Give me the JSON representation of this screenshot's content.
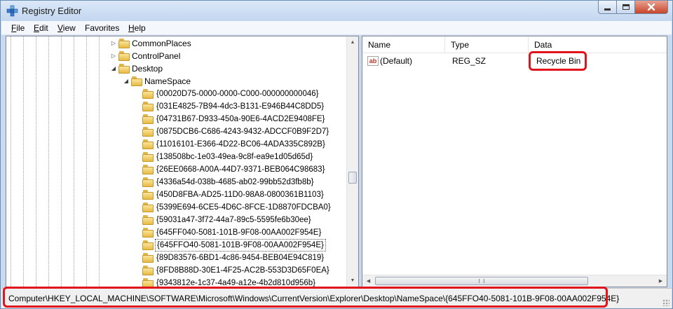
{
  "window": {
    "title": "Registry Editor"
  },
  "menu": [
    {
      "mnemonic": "F",
      "rest": "ile"
    },
    {
      "mnemonic": "E",
      "rest": "dit"
    },
    {
      "mnemonic": "V",
      "rest": "iew"
    },
    {
      "mnemonic": "",
      "rest": "Favorites"
    },
    {
      "mnemonic": "H",
      "rest": "elp"
    }
  ],
  "tree": {
    "parents": [
      {
        "label": "CommonPlaces",
        "state": "collapsed"
      },
      {
        "label": "ControlPanel",
        "state": "collapsed"
      },
      {
        "label": "Desktop",
        "state": "expanded"
      },
      {
        "label": "NameSpace",
        "state": "expanded"
      }
    ],
    "children": [
      "{00020D75-0000-0000-C000-000000000046}",
      "{031E4825-7B94-4dc3-B131-E946B44C8DD5}",
      "{04731B67-D933-450a-90E6-4ACD2E9408FE}",
      "{0875DCB6-C686-4243-9432-ADCCF0B9F2D7}",
      "{11016101-E366-4D22-BC06-4ADA335C892B}",
      "{138508bc-1e03-49ea-9c8f-ea9e1d05d65d}",
      "{26EE0668-A00A-44D7-9371-BEB064C98683}",
      "{4336a54d-038b-4685-ab02-99bb52d3fb8b}",
      "{450D8FBA-AD25-11D0-98A8-0800361B1103}",
      "{5399E694-6CE5-4D6C-8FCE-1D8870FDCBA0}",
      "{59031a47-3f72-44a7-89c5-5595fe6b30ee}",
      "{645FF040-5081-101B-9F08-00AA002F954E}",
      "{645FFO40-5081-101B-9F08-00AA002F954E}",
      "{89D83576-6BD1-4c86-9454-BEB04E94C819}",
      "{8FD8B88D-30E1-4F25-AC2B-553D3D65F0EA}",
      "{9343812e-1c37-4a49-a12e-4b2d810d956b}"
    ],
    "selected_index": 12
  },
  "list": {
    "headers": {
      "name": "Name",
      "type": "Type",
      "data": "Data"
    },
    "rows": [
      {
        "icon": "ab",
        "name": "(Default)",
        "type": "REG_SZ",
        "data": "Recycle Bin"
      }
    ]
  },
  "status": {
    "path": "Computer\\HKEY_LOCAL_MACHINE\\SOFTWARE\\Microsoft\\Windows\\CurrentVersion\\Explorer\\Desktop\\NameSpace\\{645FFO40-5081-101B-9F08-00AA002F954E}"
  },
  "colors": {
    "highlight": "#e0141a",
    "folder": "#e7bb45"
  }
}
